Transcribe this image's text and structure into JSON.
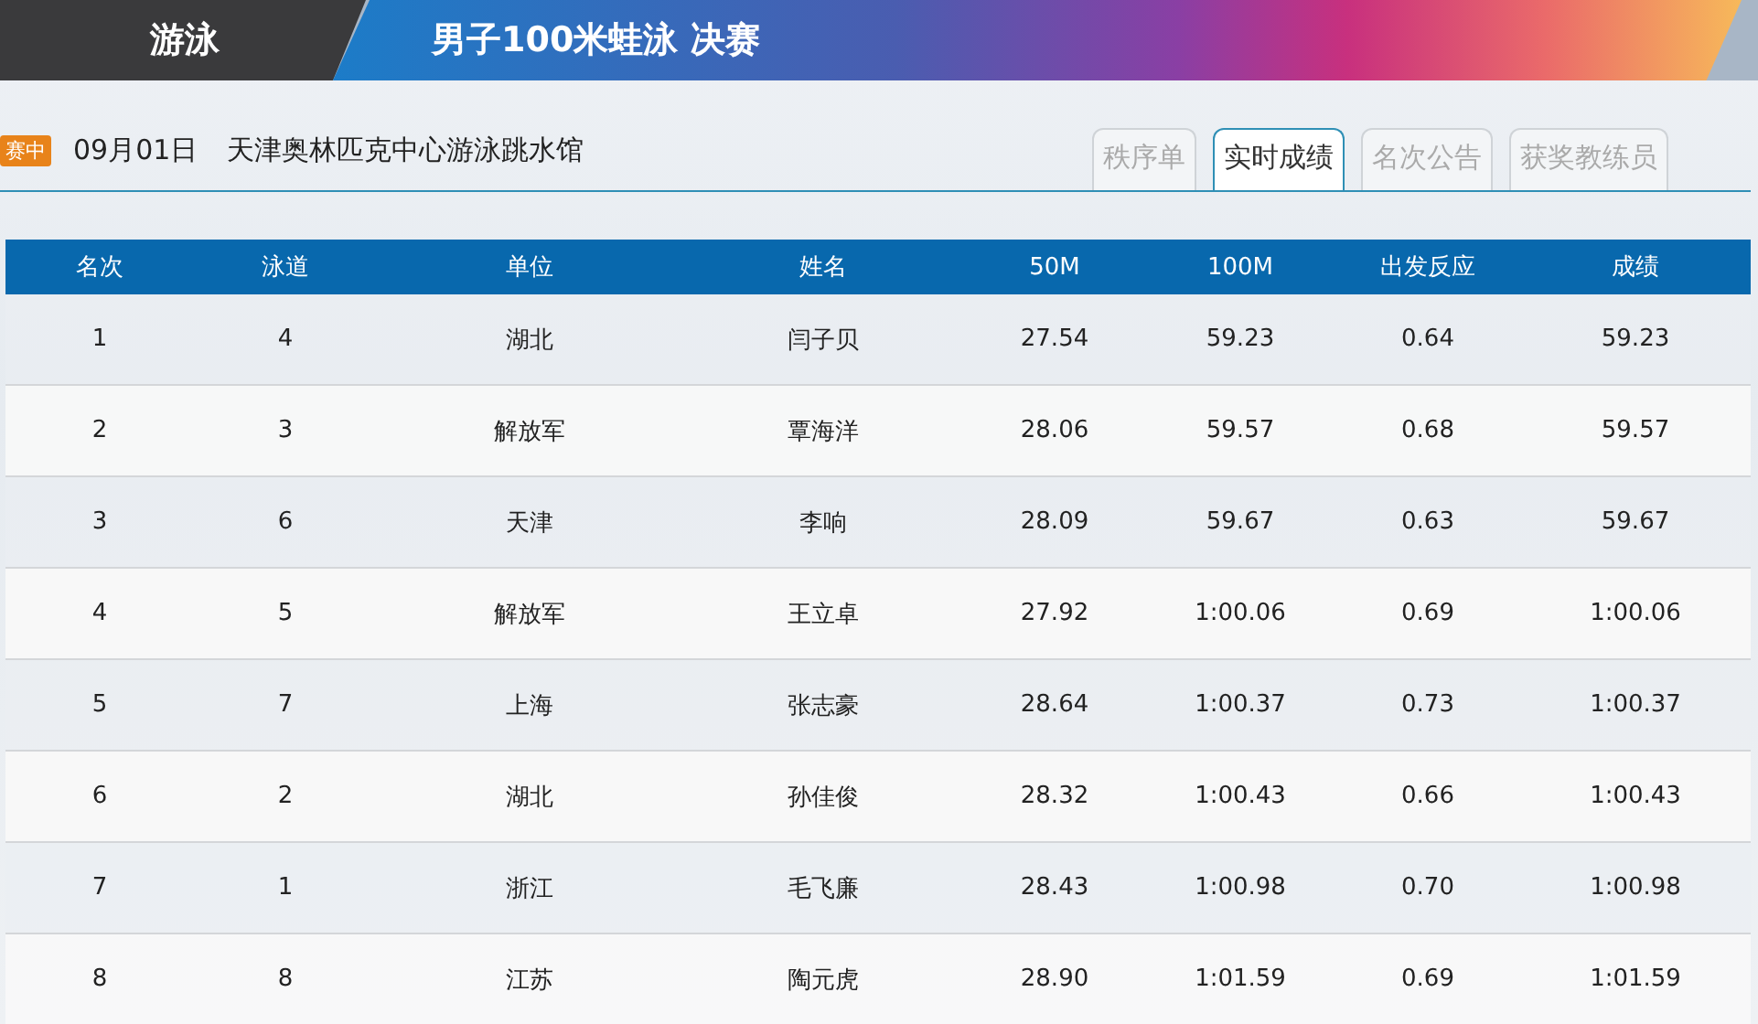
{
  "header": {
    "sport": "游泳",
    "event": "男子100米蛙泳 决赛"
  },
  "info": {
    "status_badge": "赛中",
    "date": "09月01日",
    "venue": "天津奥林匹克中心游泳跳水馆"
  },
  "tabs": [
    {
      "label": "秩序单",
      "selected": false
    },
    {
      "label": "实时成绩",
      "selected": true
    },
    {
      "label": "名次公告",
      "selected": false
    },
    {
      "label": "获奖教练员",
      "selected": false
    }
  ],
  "table": {
    "columns": [
      "名次",
      "泳道",
      "单位",
      "姓名",
      "50M",
      "100M",
      "出发反应",
      "成绩"
    ],
    "rows": [
      [
        "1",
        "4",
        "湖北",
        "闫子贝",
        "27.54",
        "59.23",
        "0.64",
        "59.23"
      ],
      [
        "2",
        "3",
        "解放军",
        "覃海洋",
        "28.06",
        "59.57",
        "0.68",
        "59.57"
      ],
      [
        "3",
        "6",
        "天津",
        "李响",
        "28.09",
        "59.67",
        "0.63",
        "59.67"
      ],
      [
        "4",
        "5",
        "解放军",
        "王立卓",
        "27.92",
        "1:00.06",
        "0.69",
        "1:00.06"
      ],
      [
        "5",
        "7",
        "上海",
        "张志豪",
        "28.64",
        "1:00.37",
        "0.73",
        "1:00.37"
      ],
      [
        "6",
        "2",
        "湖北",
        "孙佳俊",
        "28.32",
        "1:00.43",
        "0.66",
        "1:00.43"
      ],
      [
        "7",
        "1",
        "浙江",
        "毛飞廉",
        "28.43",
        "1:00.98",
        "0.70",
        "1:00.98"
      ],
      [
        "8",
        "8",
        "江苏",
        "陶元虎",
        "28.90",
        "1:01.59",
        "0.69",
        "1:01.59"
      ]
    ]
  }
}
